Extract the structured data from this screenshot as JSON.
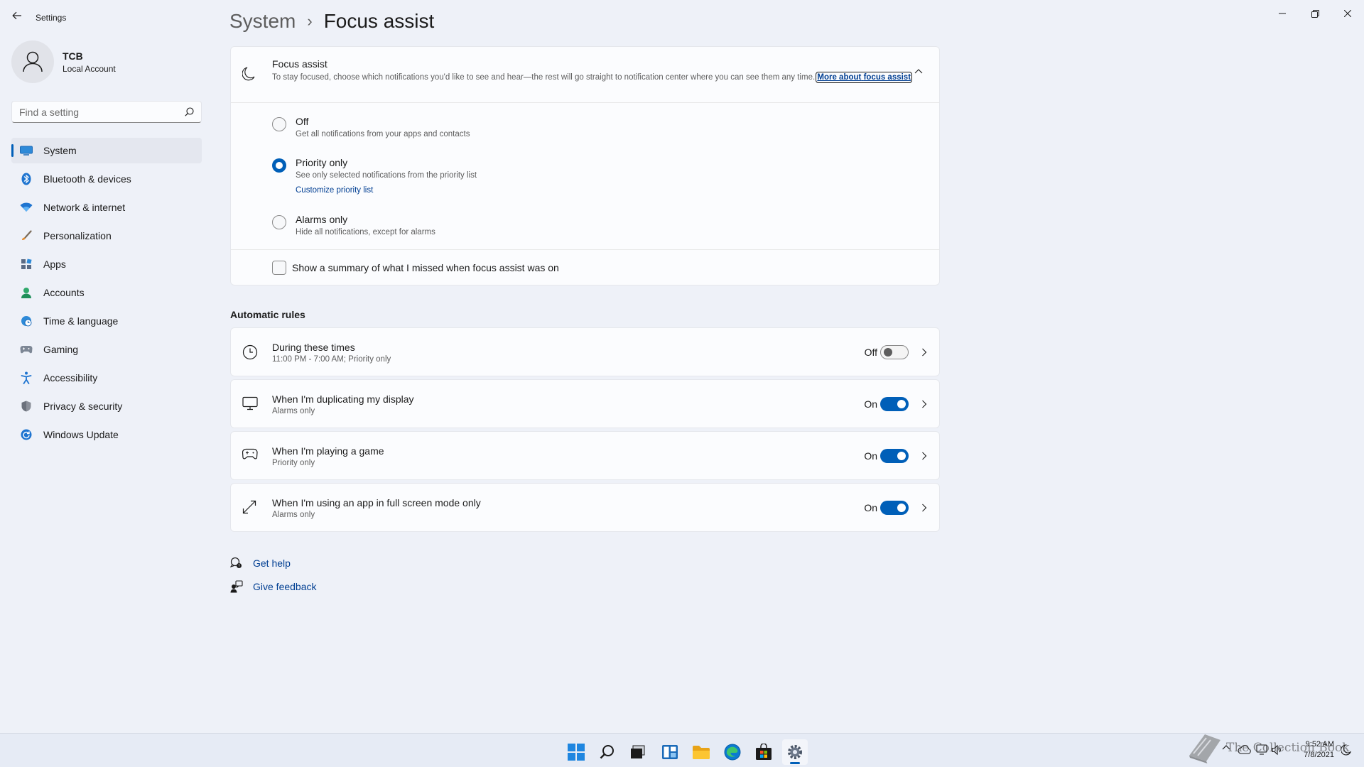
{
  "window": {
    "app_title": "Settings"
  },
  "profile": {
    "name": "TCB",
    "account_type": "Local Account"
  },
  "search": {
    "placeholder": "Find a setting"
  },
  "sidebar": {
    "items": [
      {
        "label": "System",
        "icon": "system-icon",
        "active": true
      },
      {
        "label": "Bluetooth & devices",
        "icon": "bluetooth-icon"
      },
      {
        "label": "Network & internet",
        "icon": "wifi-icon"
      },
      {
        "label": "Personalization",
        "icon": "brush-icon"
      },
      {
        "label": "Apps",
        "icon": "apps-icon"
      },
      {
        "label": "Accounts",
        "icon": "accounts-icon"
      },
      {
        "label": "Time & language",
        "icon": "globe-clock-icon"
      },
      {
        "label": "Gaming",
        "icon": "gamepad-icon"
      },
      {
        "label": "Accessibility",
        "icon": "accessibility-icon"
      },
      {
        "label": "Privacy & security",
        "icon": "shield-icon"
      },
      {
        "label": "Windows Update",
        "icon": "update-icon"
      }
    ]
  },
  "breadcrumb": {
    "parent": "System",
    "separator": "›",
    "current": "Focus assist"
  },
  "focus_assist": {
    "title": "Focus assist",
    "description": "To stay focused, choose which notifications you'd like to see and hear—the rest will go straight to notification center where you can see them any time.",
    "link_part1": "More about",
    "link_part2": "focus assist",
    "options": [
      {
        "label": "Off",
        "description": "Get all notifications from your apps and contacts",
        "checked": false
      },
      {
        "label": "Priority only",
        "description": "See only selected notifications from the priority list",
        "link": "Customize priority list",
        "checked": true
      },
      {
        "label": "Alarms only",
        "description": "Hide all notifications, except for alarms",
        "checked": false
      }
    ],
    "summary_checkbox": {
      "label": "Show a summary of what I missed when focus assist was on",
      "checked": false
    }
  },
  "automatic_rules": {
    "heading": "Automatic rules",
    "rules": [
      {
        "title": "During these times",
        "subtitle": "11:00 PM - 7:00 AM; Priority only",
        "state": "Off",
        "on": false,
        "icon": "clock-icon"
      },
      {
        "title": "When I'm duplicating my display",
        "subtitle": "Alarms only",
        "state": "On",
        "on": true,
        "icon": "monitor-icon"
      },
      {
        "title": "When I'm playing a game",
        "subtitle": "Priority only",
        "state": "On",
        "on": true,
        "icon": "gamepad-icon"
      },
      {
        "title": "When I'm using an app in full screen mode only",
        "subtitle": "Alarms only",
        "state": "On",
        "on": true,
        "icon": "fullscreen-icon"
      }
    ]
  },
  "help": {
    "get_help": "Get help",
    "give_feedback": "Give feedback"
  },
  "taskbar": {
    "apps": [
      "start-icon",
      "search-icon",
      "task-view-icon",
      "widgets-icon",
      "file-explorer-icon",
      "edge-icon",
      "store-icon",
      "settings-icon"
    ],
    "active_app": "settings-icon",
    "time": "9:52 AM",
    "date": "7/8/2021"
  },
  "watermark": {
    "text": "The Collection Book"
  },
  "colors": {
    "accent": "#005fb8",
    "link": "#003e92",
    "background": "#eef1f8",
    "card": "#fbfcfe"
  }
}
